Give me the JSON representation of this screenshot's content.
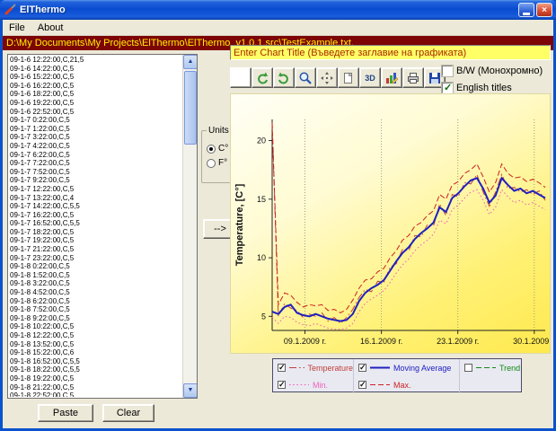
{
  "window": {
    "title": "ElThermo"
  },
  "window_controls": [
    {
      "name": "minimize-button"
    },
    {
      "name": "close-button"
    }
  ],
  "menu": {
    "items": [
      {
        "label": "File"
      },
      {
        "label": "About"
      }
    ]
  },
  "path_bar": {
    "text": "D:\\My Documents\\My Projects\\ElThermo\\ElThermo_v1.0.1.src\\TestExample.txt,"
  },
  "data_list": {
    "items": [
      "09-1-6 12:22:00,C,21,5",
      "09-1-6 14:22:00,C,5",
      "09-1-6 15:22:00,C,5",
      "09-1-6 16:22:00,C,5",
      "09-1-6 18:22:00,C,5",
      "09-1-6 19:22:00,C,5",
      "09-1-6 22:52:00,C,5",
      "09-1-7 0:22:00,C,5",
      "09-1-7 1:22:00,C,5",
      "09-1-7 3:22:00,C,5",
      "09-1-7 4:22:00,C,5",
      "09-1-7 6:22:00,C,5",
      "09-1-7 7:22:00,C,5",
      "09-1-7 7:52:00,C,5",
      "09-1-7 9:22:00,C,5",
      "09-1-7 12:22:00,C,5",
      "09-1-7 13:22:00,C,4",
      "09-1-7 14:22:00,C,5,5",
      "09-1-7 16:22:00,C,5",
      "09-1-7 16:52:00,C,5,5",
      "09-1-7 18:22:00,C,5",
      "09-1-7 19:22:00,C,5",
      "09-1-7 21:22:00,C,5",
      "09-1-7 23:22:00,C,5",
      "09-1-8 0:22:00,C,5",
      "09-1-8 1:52:00,C,5",
      "09-1-8 3:22:00,C,5",
      "09-1-8 4:52:00,C,5",
      "09-1-8 6:22:00,C,5",
      "09-1-8 7:52:00,C,5",
      "09-1-8 9:22:00,C,5",
      "09-1-8 10:22:00,C,5",
      "09-1-8 12:22:00,C,5",
      "09-1-8 13:52:00,C,5",
      "09-1-8 15:22:00,C,6",
      "09-1-8 16:52:00,C,5,5",
      "09-1-8 18:22:00,C,5,5",
      "09-1-8 19:22:00,C,5",
      "09-1-8 21:22:00,C,5",
      "09-1-8 22:52:00,C,5"
    ]
  },
  "units": {
    "label": "Units",
    "options": [
      {
        "label": "C°",
        "selected": true
      },
      {
        "label": "F°",
        "selected": false
      }
    ]
  },
  "transfer_button": {
    "label": "-->"
  },
  "chart_title_input": {
    "value": "Enter Chart Title (Въведете заглавие на графиката)"
  },
  "options": {
    "bw": {
      "label": "B/W (Монохромно)",
      "checked": false
    },
    "english": {
      "label": "English titles",
      "checked": true
    }
  },
  "toolbar": {
    "buttons": [
      {
        "name": "blank-tool"
      },
      {
        "name": "rotate-ccw"
      },
      {
        "name": "rotate-cw"
      },
      {
        "name": "zoom"
      },
      {
        "name": "pan"
      },
      {
        "name": "copy-page"
      },
      {
        "name": "threed",
        "label": "3D"
      },
      {
        "name": "edit-chart"
      },
      {
        "name": "print"
      },
      {
        "name": "save"
      }
    ]
  },
  "legend": {
    "items": [
      {
        "label": "Temperature",
        "color": "#C04038",
        "style": "dashdot",
        "checked": true
      },
      {
        "label": "Moving Average",
        "color": "#2020C0",
        "style": "solid",
        "checked": true
      },
      {
        "label": "Trend",
        "color": "#108810",
        "style": "dash",
        "checked": false
      },
      {
        "label": "Min.",
        "color": "#F060B8",
        "style": "dot",
        "checked": true
      },
      {
        "label": "Max.",
        "color": "#CC2020",
        "style": "dash",
        "checked": true
      }
    ]
  },
  "buttons": {
    "paste": "Paste",
    "clear": "Clear"
  },
  "chart_data": {
    "type": "line",
    "title": "",
    "ylabel": "Temperature, [C°]",
    "yticks": [
      5,
      10,
      15,
      20
    ],
    "x_tick_days": [
      9,
      16,
      23,
      30
    ],
    "x_tick_labels": [
      "09.1.2009 г.",
      "16.1.2009 г.",
      "23.1.2009 г.",
      "30.1.2009 г."
    ],
    "xlim": [
      6,
      31
    ],
    "ylim": [
      3.8,
      21.8
    ],
    "x_start": 6,
    "x_end": 31,
    "series": [
      {
        "name": "Temperature",
        "color": "#C04038",
        "style": "dashdot",
        "width": 1,
        "visible": true,
        "values": [
          21.5,
          5.0,
          6.1,
          5.7,
          5.5,
          4.9,
          5.2,
          5.0,
          5.3,
          4.6,
          4.9,
          4.4,
          4.9,
          5.6,
          6.6,
          7.3,
          7.1,
          8.0,
          7.9,
          9.2,
          9.5,
          10.7,
          10.6,
          11.9,
          11.8,
          12.8,
          12.7,
          14.6,
          13.6,
          15.4,
          15.2,
          16.4,
          16.3,
          17.1,
          15.6,
          14.4,
          15.6,
          17.1,
          15.9,
          16.0,
          15.6,
          15.8,
          15.4,
          15.7,
          14.9
        ]
      },
      {
        "name": "Moving Average",
        "color": "#2020C0",
        "style": "solid",
        "width": 2,
        "visible": true,
        "values": [
          5.4,
          5.2,
          5.8,
          6.0,
          5.3,
          5.1,
          5.0,
          5.2,
          5.0,
          4.8,
          4.7,
          4.6,
          4.7,
          5.2,
          6.3,
          7.0,
          7.4,
          7.7,
          8.1,
          8.9,
          9.7,
          10.4,
          10.9,
          11.6,
          12.1,
          12.5,
          13.0,
          14.3,
          13.9,
          15.1,
          15.5,
          16.1,
          16.6,
          16.8,
          15.9,
          14.7,
          15.3,
          16.8,
          16.2,
          15.7,
          15.9,
          15.5,
          15.7,
          15.4,
          15.1
        ]
      },
      {
        "name": "Trend",
        "color": "#108810",
        "style": "dash",
        "width": 1,
        "visible": false,
        "values": []
      },
      {
        "name": "Min.",
        "color": "#F060B8",
        "style": "dot",
        "width": 1,
        "visible": true,
        "values": [
          4.9,
          4.4,
          5.0,
          4.9,
          4.5,
          4.3,
          4.2,
          4.4,
          4.2,
          4.0,
          3.9,
          3.9,
          4.0,
          4.4,
          5.4,
          6.1,
          6.5,
          6.8,
          7.2,
          7.9,
          8.7,
          9.4,
          9.9,
          10.6,
          11.1,
          11.5,
          12.0,
          13.2,
          12.9,
          14.1,
          14.5,
          15.1,
          15.6,
          15.8,
          14.9,
          13.7,
          14.3,
          15.8,
          15.2,
          14.7,
          14.9,
          14.5,
          14.7,
          14.4,
          14.1
        ]
      },
      {
        "name": "Max.",
        "color": "#CC2020",
        "style": "dash",
        "width": 1,
        "visible": true,
        "values": [
          21.5,
          6.0,
          7.0,
          6.8,
          6.2,
          5.8,
          6.0,
          5.9,
          6.0,
          5.5,
          5.6,
          5.3,
          5.6,
          6.4,
          7.4,
          8.1,
          8.2,
          8.8,
          9.1,
          10.0,
          10.6,
          11.5,
          11.9,
          12.7,
          13.0,
          13.6,
          14.0,
          15.4,
          15.0,
          16.2,
          16.5,
          17.2,
          17.5,
          18.0,
          16.9,
          15.6,
          16.4,
          18.0,
          17.2,
          16.8,
          16.9,
          16.5,
          16.7,
          16.4,
          16.0
        ]
      }
    ]
  }
}
